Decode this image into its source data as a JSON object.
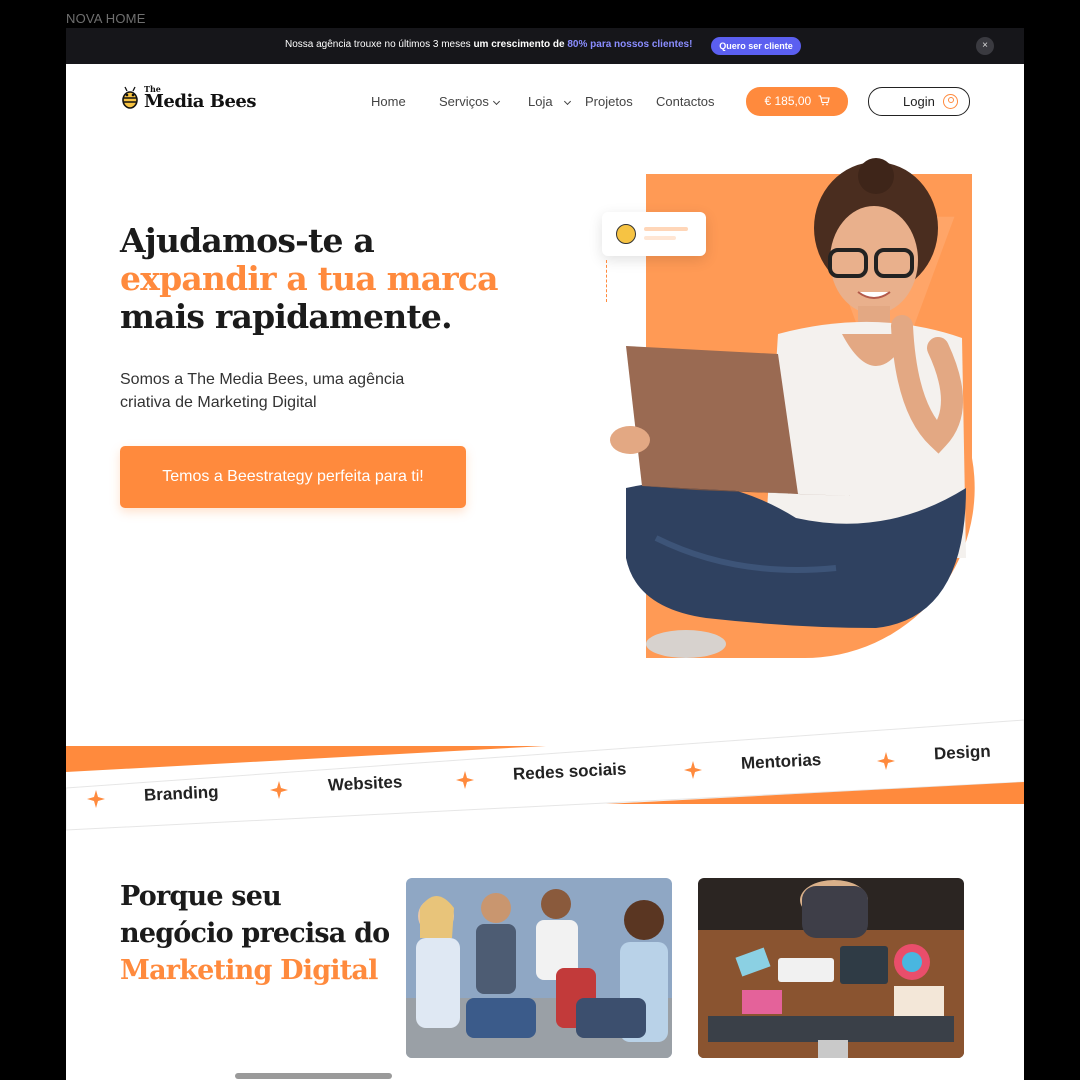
{
  "frame_label": "NOVA HOME",
  "promo": {
    "text_pre": "Nossa agência trouxe no últimos 3 meses ",
    "text_bold": "um crescimento de ",
    "text_highlight": "80% para nossos clientes!",
    "button": "Quero ser cliente",
    "close": "×"
  },
  "brand": {
    "the": "The",
    "name": "Media Bees"
  },
  "nav": [
    {
      "label": "Home"
    },
    {
      "label": "Serviços"
    },
    {
      "label": "Loja"
    },
    {
      "label": "Projetos"
    },
    {
      "label": "Contactos"
    }
  ],
  "cart": {
    "label": "€ 185,00",
    "icon": "cart-icon"
  },
  "login": {
    "label": "Login",
    "icon": "user-icon"
  },
  "hero": {
    "title_line1": "Ajudamos-te a",
    "title_line2": "expandir a tua marca",
    "title_line3": "mais rapidamente.",
    "subtitle": "Somos a The Media Bees, uma agência criativa de Marketing Digital",
    "cta": "Temos a Beestrategy perfeita para ti!"
  },
  "ticker": [
    "Branding",
    "Websites",
    "Redes sociais",
    "Mentorias",
    "Design"
  ],
  "section": {
    "title_line1": "Porque seu",
    "title_line2": "negócio precisa do",
    "title_line3": "Marketing Digital"
  },
  "colors": {
    "accent": "#ff8a3d",
    "promo_bg": "#16161a",
    "promo_button": "#5b5ff0",
    "text": "#1b1b1b"
  }
}
